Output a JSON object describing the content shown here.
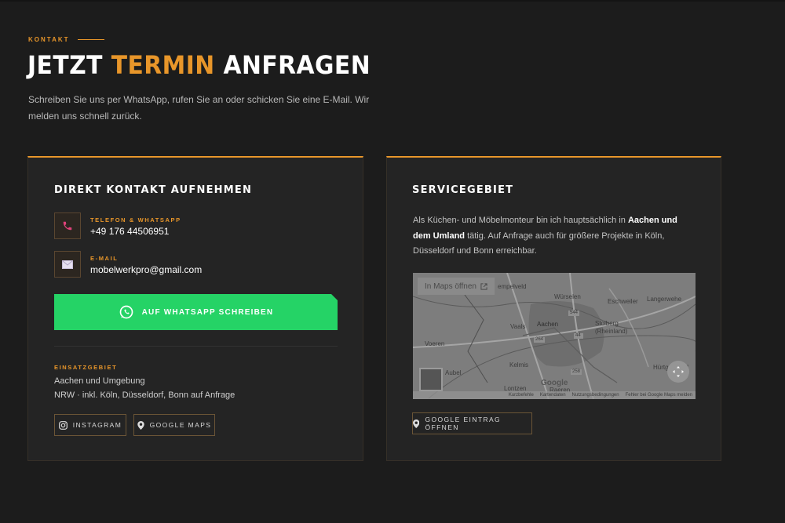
{
  "section": {
    "eyebrow": "KONTAKT",
    "title_part1": "JETZT",
    "title_accent": "TERMIN",
    "title_part2": "ANFRAGEN",
    "intro": "Schreiben Sie uns per WhatsApp, rufen Sie an oder schicken Sie eine E-Mail. Wir melden uns schnell zurück."
  },
  "contact_card": {
    "heading": "DIREKT KONTAKT AUFNEHMEN",
    "phone_label": "TELEFON & WHATSAPP",
    "phone_value": "+49 176 44506951",
    "email_label": "E-MAIL",
    "email_value": "mobelwerkpro@gmail.com",
    "whatsapp_button": "AUF WHATSAPP SCHREIBEN",
    "area_label": "EINSATZGEBIET",
    "area_line1": "Aachen und Umgebung",
    "area_line2": "NRW · inkl. Köln, Düsseldorf, Bonn auf Anfrage",
    "instagram_button": "INSTAGRAM",
    "maps_button": "GOOGLE MAPS"
  },
  "service_card": {
    "heading": "SERVICEGEBIET",
    "text_before": "Als Küchen- und Möbelmonteur bin ich hauptsächlich in ",
    "text_bold": "Aachen und dem Umland",
    "text_after": " tätig. Auf Anfrage auch für größere Projekte in Köln, Düsseldorf und Bonn erreichbar.",
    "map": {
      "open_label": "In Maps öffnen",
      "places": [
        "Würselen",
        "Eschweiler",
        "Langerwehe",
        "Aachen",
        "Stolberg (Rheinland)",
        "Vaals",
        "Voeren",
        "Kelmis",
        "Aubel",
        "Lontzen",
        "Raeren",
        "Hürtgenwald",
        "empelveld"
      ],
      "road_labels": [
        "544",
        "44",
        "264",
        "258"
      ],
      "google_logo": "Google",
      "footer": [
        "Kurzbefehle",
        "Kartendaten",
        "Nutzungsbedingungen",
        "Fehler bei Google Maps melden"
      ]
    },
    "google_entry_button": "GOOGLE EINTRAG ÖFFNEN"
  },
  "colors": {
    "accent": "#e8962a",
    "whatsapp": "#25d366",
    "background": "#1c1c1c",
    "card": "#242424"
  },
  "icons": {
    "phone": "phone-icon",
    "email": "envelope-icon",
    "whatsapp": "whatsapp-icon",
    "instagram": "instagram-icon",
    "location": "map-pin-icon",
    "external": "external-link-icon"
  }
}
